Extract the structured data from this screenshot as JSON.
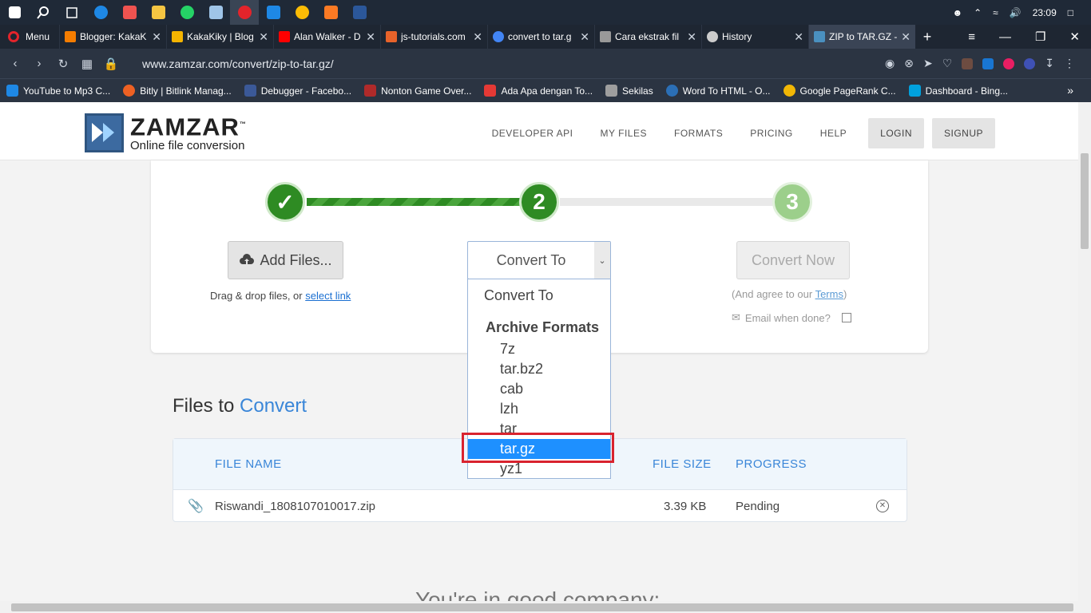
{
  "system": {
    "time": "23:09"
  },
  "browser": {
    "menu_label": "Menu",
    "tabs": [
      {
        "title": "Blogger: KakaK",
        "color": "#f57d00"
      },
      {
        "title": "KakaKiky | Blog",
        "color": "#f5b400"
      },
      {
        "title": "Alan Walker - D",
        "color": "#ff0000"
      },
      {
        "title": "js-tutorials.com",
        "color": "#e8632a"
      },
      {
        "title": "convert to tar.g",
        "color": "#4285f4"
      },
      {
        "title": "Cara ekstrak fil",
        "color": "#999999"
      },
      {
        "title": "History",
        "color": "#cccccc"
      },
      {
        "title": "ZIP to TAR.GZ -",
        "color": "#4a90c0"
      }
    ],
    "url": "www.zamzar.com/convert/zip-to-tar.gz/",
    "bookmarks": [
      {
        "label": "YouTube to Mp3 C...",
        "color": "#1e88e5"
      },
      {
        "label": "Bitly | Bitlink Manag...",
        "color": "#ee6123"
      },
      {
        "label": "Debugger - Facebo...",
        "color": "#3b5998"
      },
      {
        "label": "Nonton Game Over...",
        "color": "#b02a2a"
      },
      {
        "label": "Ada Apa dengan To...",
        "color": "#e53935"
      },
      {
        "label": "Sekilas",
        "color": "#9e9e9e"
      },
      {
        "label": "Word To HTML - O...",
        "color": "#2b6fb6"
      },
      {
        "label": "Google PageRank C...",
        "color": "#f2b705"
      },
      {
        "label": "Dashboard - Bing...",
        "color": "#00a1de"
      }
    ]
  },
  "site": {
    "logo_title": "ZAMZAR",
    "logo_tm": "™",
    "logo_tagline": "Online file conversion",
    "nav": {
      "developer_api": "DEVELOPER API",
      "my_files": "MY FILES",
      "formats": "FORMATS",
      "pricing": "PRICING",
      "help": "HELP",
      "login": "LOGIN",
      "signup": "SIGNUP"
    }
  },
  "converter": {
    "step1": "✓",
    "step2": "2",
    "step3": "3",
    "add_files": "Add Files...",
    "drag_text": "Drag & drop files, or ",
    "select_link": "select link",
    "convert_to": "Convert To",
    "convert_now": "Convert Now",
    "agree_prefix": "(And agree to our ",
    "terms": "Terms",
    "agree_suffix": ")",
    "email_label": "Email when done?"
  },
  "dropdown": {
    "header": "Convert To",
    "group": "Archive Formats",
    "options": [
      "7z",
      "tar.bz2",
      "cab",
      "lzh",
      "tar",
      "tar.gz",
      "yz1"
    ],
    "selected": "tar.gz"
  },
  "files": {
    "title_prefix": "Files to ",
    "title_accent": "Convert",
    "columns": {
      "name": "FILE NAME",
      "size": "FILE SIZE",
      "progress": "PROGRESS"
    },
    "rows": [
      {
        "name": "Riswandi_1808107010017.zip",
        "size": "3.39 KB",
        "progress": "Pending"
      }
    ]
  },
  "footer_teaser": "You're in good company:"
}
